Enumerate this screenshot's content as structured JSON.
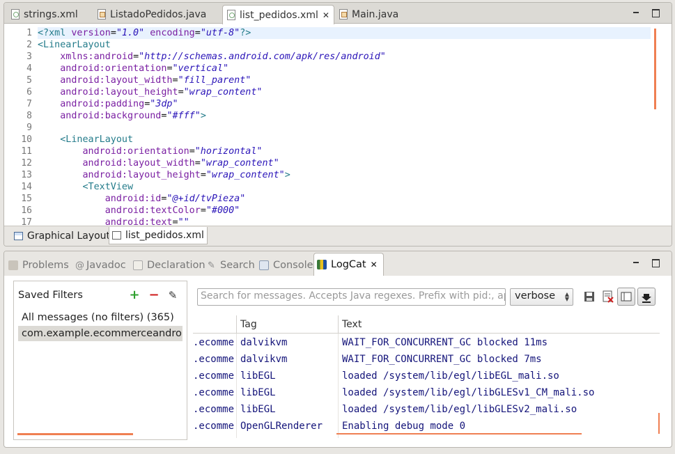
{
  "editor": {
    "tabs": [
      {
        "label": "strings.xml",
        "icon": "xml-file-icon"
      },
      {
        "label": "ListadoPedidos.java",
        "icon": "java-file-icon"
      },
      {
        "label": "list_pedidos.xml",
        "icon": "xml-file-icon",
        "active": true
      },
      {
        "label": "Main.java",
        "icon": "java-file-icon"
      }
    ],
    "line_numbers": [
      "1",
      "2",
      "3",
      "4",
      "5",
      "6",
      "7",
      "8",
      "9",
      "10",
      "11",
      "12",
      "13",
      "14",
      "15",
      "16",
      "17"
    ],
    "lines": [
      {
        "tag": "<?xml ",
        "attr1": "version",
        "val1": "\"1.0\"",
        "attr2": " encoding",
        "val2": "\"utf-8\"",
        "end": "?>"
      },
      {
        "tag": "<LinearLayout"
      },
      {
        "attr": "xmlns:android",
        "val": "\"http://schemas.android.com/apk/res/android\""
      },
      {
        "attr": "android:orientation",
        "val": "\"vertical\""
      },
      {
        "attr": "android:layout_width",
        "val": "\"fill_parent\""
      },
      {
        "attr": "android:layout_height",
        "val": "\"wrap_content\""
      },
      {
        "attr": "android:padding",
        "val": "\"3dp\""
      },
      {
        "attr": "android:background",
        "val": "\"#fff\"",
        "end": ">"
      },
      {},
      {
        "tag": "<LinearLayout"
      },
      {
        "attr": "android:orientation",
        "val": "\"horizontal\""
      },
      {
        "attr": "android:layout_width",
        "val": "\"wrap_content\""
      },
      {
        "attr": "android:layout_height",
        "val": "\"wrap_content\"",
        "end": ">"
      },
      {
        "tag": "<TextView"
      },
      {
        "attr": "android:id",
        "val": "\"@+id/tvPieza\""
      },
      {
        "attr": "android:textColor",
        "val": "\"#000\""
      },
      {
        "attr": "android:text",
        "val": "\"\""
      }
    ],
    "bottom_tabs": [
      {
        "label": "Graphical Layout"
      },
      {
        "label": "list_pedidos.xml",
        "active": true
      }
    ]
  },
  "views": {
    "tabs": [
      {
        "label": "Problems",
        "icon": "problems-icon"
      },
      {
        "label": "Javadoc",
        "icon": "javadoc-icon"
      },
      {
        "label": "Declaration",
        "icon": "declaration-icon"
      },
      {
        "label": "Search",
        "icon": "search-icon"
      },
      {
        "label": "Console",
        "icon": "console-icon"
      },
      {
        "label": "LogCat",
        "icon": "logcat-icon",
        "active": true
      }
    ]
  },
  "logcat": {
    "saved_filters_title": "Saved Filters",
    "filters": [
      {
        "label": "All messages (no filters) (365)"
      },
      {
        "label": "com.example.ecommerceandroid (",
        "selected": true
      }
    ],
    "search_placeholder": "Search for messages. Accepts Java regexes. Prefix with pid:, app:, tag: or text: to limit scope.",
    "level": "verbose",
    "columns": {
      "tag": "Tag",
      "text": "Text"
    },
    "rows": [
      {
        "app": ".ecomme",
        "tag": "dalvikvm",
        "text": "WAIT_FOR_CONCURRENT_GC blocked 11ms"
      },
      {
        "app": ".ecomme",
        "tag": "dalvikvm",
        "text": "WAIT_FOR_CONCURRENT_GC blocked 7ms"
      },
      {
        "app": ".ecomme",
        "tag": "libEGL",
        "text": "loaded /system/lib/egl/libEGL_mali.so"
      },
      {
        "app": ".ecomme",
        "tag": "libEGL",
        "text": "loaded /system/lib/egl/libGLESv1_CM_mali.so"
      },
      {
        "app": ".ecomme",
        "tag": "libEGL",
        "text": "loaded /system/lib/egl/libGLESv2_mali.so"
      },
      {
        "app": ".ecomme",
        "tag": "OpenGLRenderer",
        "text": "Enabling debug mode 0"
      }
    ]
  },
  "colors": {
    "accent": "#ef7f52",
    "log_text": "#14147a",
    "xml_tag": "#237b8a",
    "xml_attr": "#7a1fa2",
    "xml_value": "#2a14b8"
  }
}
